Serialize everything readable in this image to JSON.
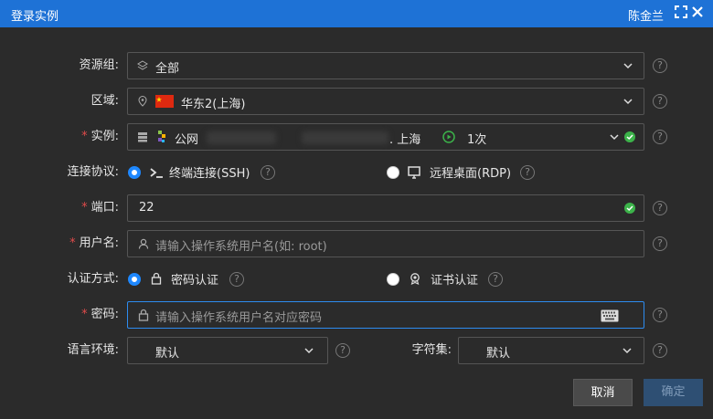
{
  "window": {
    "title": "登录实例",
    "user": "陈金兰"
  },
  "form": {
    "resource_group": {
      "label": "资源组:",
      "value": "全部"
    },
    "region": {
      "label": "区域:",
      "value": "华东2(上海)"
    },
    "instance": {
      "label": "实例:",
      "network": "公网",
      "location": ". 上海",
      "count": "1次"
    },
    "protocol": {
      "label": "连接协议:",
      "options": [
        "终端连接(SSH)",
        "远程桌面(RDP)"
      ],
      "selected": "终端连接(SSH)"
    },
    "port": {
      "label": "端口:",
      "value": "22"
    },
    "username": {
      "label": "用户名:",
      "placeholder": "请输入操作系统用户名(如: root)"
    },
    "auth": {
      "label": "认证方式:",
      "options": [
        "密码认证",
        "证书认证"
      ],
      "selected": "密码认证"
    },
    "password": {
      "label": "密码:",
      "placeholder": "请输入操作系统用户名对应密码"
    },
    "locale": {
      "label": "语言环境:",
      "value": "默认"
    },
    "charset": {
      "label": "字符集:",
      "value": "默认"
    }
  },
  "buttons": {
    "cancel": "取消",
    "confirm": "确定"
  },
  "colors": {
    "titlebar": "#1e72d6",
    "accent": "#2d8cf0",
    "required": "#e14b4b",
    "success": "#3cb34a",
    "background": "#2b2b2b"
  },
  "icons": [
    "layers-icon",
    "location-pin-icon",
    "china-flag-icon",
    "server-icon",
    "instance-os-icon",
    "play-circle-icon",
    "terminal-icon",
    "monitor-icon",
    "user-icon",
    "lock-icon",
    "certificate-icon",
    "keyboard-icon",
    "help-icon",
    "chevron-down-icon",
    "check-circle-icon",
    "fullscreen-icon",
    "close-icon"
  ]
}
